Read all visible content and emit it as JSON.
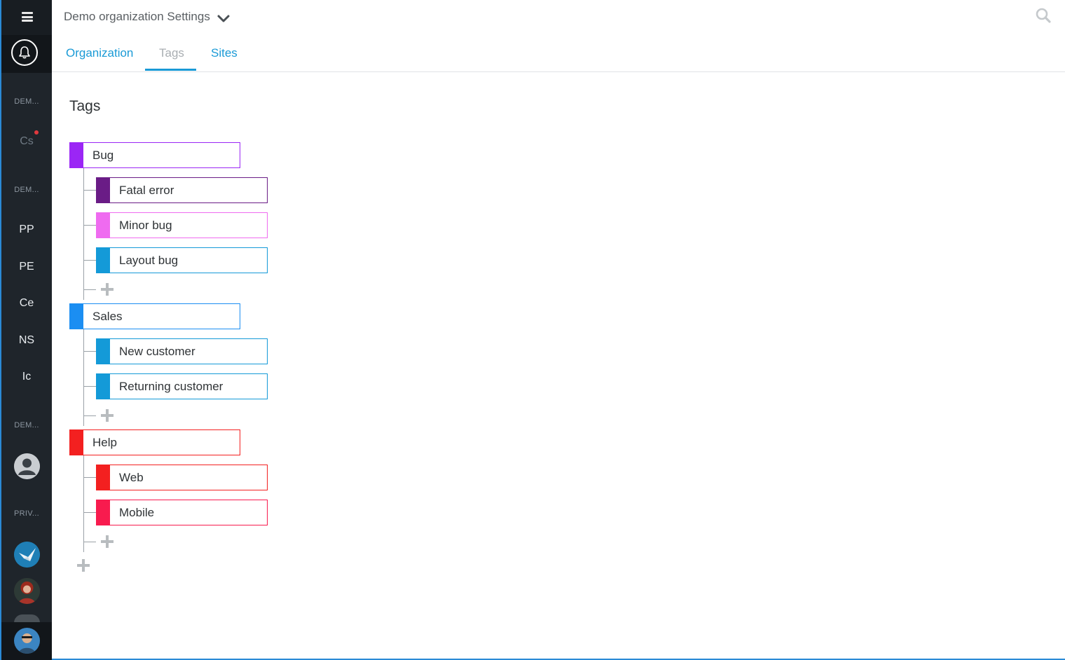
{
  "header": {
    "title": "Demo organization Settings"
  },
  "tabs": [
    {
      "label": "Organization",
      "active": false
    },
    {
      "label": "Tags",
      "active": true
    },
    {
      "label": "Sites",
      "active": false
    }
  ],
  "page_title": "Tags",
  "sidebar": {
    "sections": [
      {
        "label": "DEM...",
        "items": [
          {
            "label": "Cs",
            "unread": true
          }
        ]
      },
      {
        "label": "DEM...",
        "items": [
          {
            "label": "PP"
          },
          {
            "label": "PE"
          },
          {
            "label": "Ce"
          },
          {
            "label": "NS"
          },
          {
            "label": "Ic"
          }
        ]
      },
      {
        "label": "DEM...",
        "items": [
          {
            "type": "avatar",
            "icon": "user-icon"
          }
        ]
      },
      {
        "label": "PRIV...",
        "items": [
          {
            "type": "avatar",
            "icon": "crane-logo"
          },
          {
            "type": "avatar",
            "icon": "user-photo"
          },
          {
            "type": "avatar",
            "icon": "user-photo"
          }
        ]
      }
    ],
    "bottom_avatar": "user-photo"
  },
  "tag_groups": [
    {
      "label": "Bug",
      "color": "#9b26f5",
      "children": [
        {
          "label": "Fatal error",
          "color": "#6a1c86"
        },
        {
          "label": "Minor bug",
          "color": "#ef6bf0"
        },
        {
          "label": "Layout bug",
          "color": "#149ad8"
        }
      ]
    },
    {
      "label": "Sales",
      "color": "#1b8ef2",
      "children": [
        {
          "label": "New customer",
          "color": "#149ad8"
        },
        {
          "label": "Returning customer",
          "color": "#149ad8"
        }
      ]
    },
    {
      "label": "Help",
      "color": "#f32020",
      "children": [
        {
          "label": "Web",
          "color": "#f32020"
        },
        {
          "label": "Mobile",
          "color": "#f81b4e"
        }
      ]
    }
  ],
  "icons": {
    "menu": "hamburger-icon",
    "notifications": "bell-icon",
    "dropdown": "chevron-down-icon",
    "search": "search-icon",
    "add": "plus-icon"
  }
}
